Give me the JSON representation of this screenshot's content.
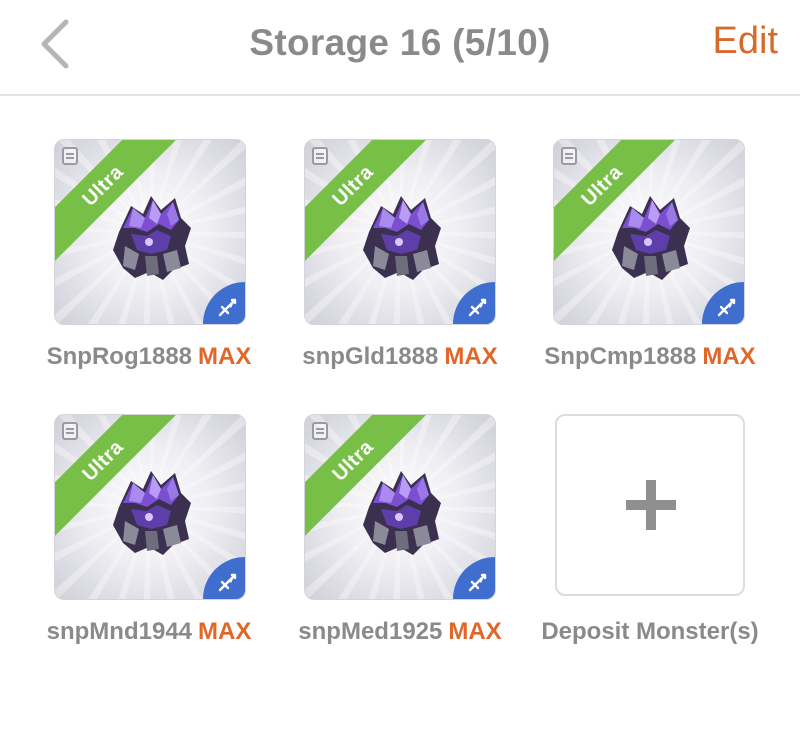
{
  "header": {
    "title": "Storage 16 (5/10)",
    "edit_label": "Edit"
  },
  "colors": {
    "accent": "#e0672a",
    "rarity_badge": "#78bf48",
    "mission_badge": "#3f6ecf",
    "text_gray": "#8a8a8a"
  },
  "monsters": [
    {
      "name": "SnpRog1888",
      "level": "MAX",
      "rarity": "Ultra",
      "icon": "purple-crystal-monster"
    },
    {
      "name": "snpGld1888",
      "level": "MAX",
      "rarity": "Ultra",
      "icon": "purple-crystal-monster"
    },
    {
      "name": "SnpCmp1888",
      "level": "MAX",
      "rarity": "Ultra",
      "icon": "purple-crystal-monster"
    },
    {
      "name": "snpMnd1944",
      "level": "MAX",
      "rarity": "Ultra",
      "icon": "purple-crystal-monster"
    },
    {
      "name": "snpMed1925",
      "level": "MAX",
      "rarity": "Ultra",
      "icon": "purple-crystal-monster"
    }
  ],
  "deposit": {
    "label": "Deposit Monster(s)"
  }
}
